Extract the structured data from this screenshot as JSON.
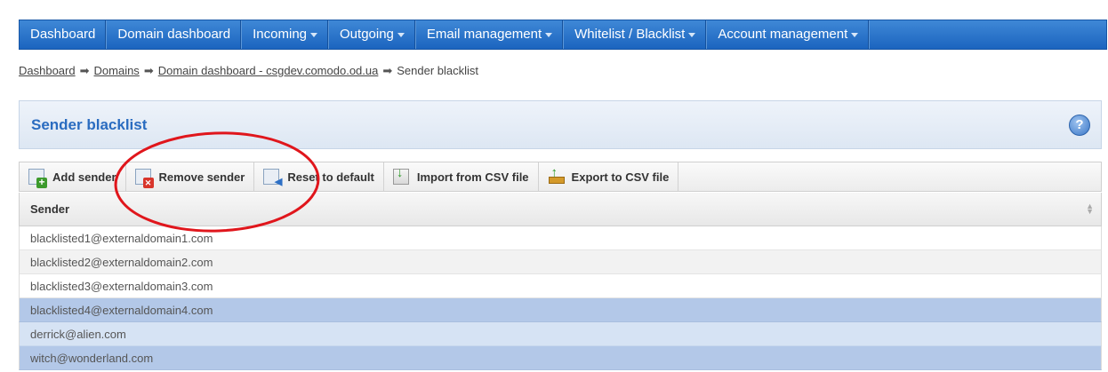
{
  "nav": {
    "items": [
      {
        "label": "Dashboard",
        "dropdown": false
      },
      {
        "label": "Domain dashboard",
        "dropdown": false
      },
      {
        "label": "Incoming",
        "dropdown": true
      },
      {
        "label": "Outgoing",
        "dropdown": true
      },
      {
        "label": "Email management",
        "dropdown": true
      },
      {
        "label": "Whitelist / Blacklist",
        "dropdown": true
      },
      {
        "label": "Account management",
        "dropdown": true
      }
    ]
  },
  "breadcrumb": {
    "links": [
      "Dashboard",
      "Domains",
      "Domain dashboard - csgdev.comodo.od.ua"
    ],
    "current": "Sender blacklist"
  },
  "panel": {
    "title": "Sender blacklist",
    "help_icon": "?"
  },
  "toolbar": {
    "buttons": [
      {
        "label": "Add sender",
        "icon": "add-icon"
      },
      {
        "label": "Remove sender",
        "icon": "remove-icon"
      },
      {
        "label": "Reset to default",
        "icon": "reset-icon"
      },
      {
        "label": "Import from CSV file",
        "icon": "import-csv-icon"
      },
      {
        "label": "Export to CSV file",
        "icon": "export-csv-icon"
      }
    ]
  },
  "table": {
    "column": "Sender",
    "rows": [
      {
        "sender": "blacklisted1@externaldomain1.com",
        "state": "normal"
      },
      {
        "sender": "blacklisted2@externaldomain2.com",
        "state": "normal"
      },
      {
        "sender": "blacklisted3@externaldomain3.com",
        "state": "normal"
      },
      {
        "sender": "blacklisted4@externaldomain4.com",
        "state": "selected"
      },
      {
        "sender": "derrick@alien.com",
        "state": "hover"
      },
      {
        "sender": "witch@wonderland.com",
        "state": "selected"
      }
    ]
  },
  "colors": {
    "nav_bg": "#2a74cc",
    "title_blue": "#2a6cc0",
    "annotation_red": "#e0161c",
    "selected_row": "#b3c8e8"
  }
}
